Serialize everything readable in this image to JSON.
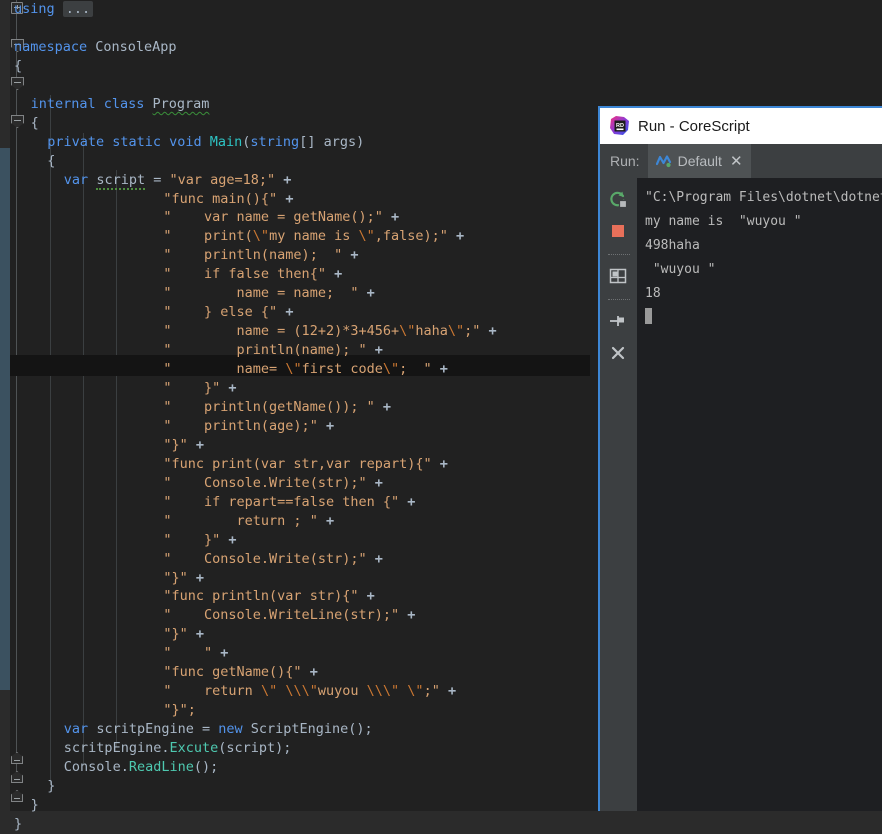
{
  "editor": {
    "language": "csharp",
    "collapsed_region_label": "...",
    "current_line_index": 15,
    "lines": [
      {
        "indent": 0,
        "tokens": [
          {
            "t": "using ",
            "c": "kw2"
          },
          {
            "t": "...",
            "c": "folded"
          }
        ]
      },
      {
        "indent": 0,
        "tokens": []
      },
      {
        "indent": 0,
        "tokens": [
          {
            "t": "namespace ",
            "c": "kw2"
          },
          {
            "t": "ConsoleApp",
            "c": "plain"
          }
        ]
      },
      {
        "indent": 0,
        "tokens": [
          {
            "t": "{",
            "c": "plain"
          }
        ]
      },
      {
        "indent": 0,
        "tokens": []
      },
      {
        "indent": 1,
        "tokens": [
          {
            "t": "internal ",
            "c": "kw2"
          },
          {
            "t": "class ",
            "c": "kw2"
          },
          {
            "t": "Program",
            "c": "plain wavy"
          }
        ]
      },
      {
        "indent": 1,
        "tokens": [
          {
            "t": "{",
            "c": "plain"
          }
        ]
      },
      {
        "indent": 2,
        "tokens": [
          {
            "t": "private ",
            "c": "kw2"
          },
          {
            "t": "static ",
            "c": "kw2"
          },
          {
            "t": "void ",
            "c": "kw2"
          },
          {
            "t": "Main",
            "c": "mainm"
          },
          {
            "t": "(",
            "c": "plain"
          },
          {
            "t": "string",
            "c": "kw2"
          },
          {
            "t": "[] args)",
            "c": "plain"
          }
        ]
      },
      {
        "indent": 2,
        "tokens": [
          {
            "t": "{",
            "c": "plain"
          }
        ]
      },
      {
        "indent": 3,
        "tokens": [
          {
            "t": "var ",
            "c": "kw2"
          },
          {
            "t": "script",
            "c": "plain dotted"
          },
          {
            "t": " = ",
            "c": "plain"
          },
          {
            "t": "\"var age=18;\"",
            "c": "str"
          },
          {
            "t": " +",
            "c": "plusop"
          }
        ]
      },
      {
        "indent": 9,
        "tokens": [
          {
            "t": "\"func main(){\"",
            "c": "str"
          },
          {
            "t": " +",
            "c": "plusop"
          }
        ]
      },
      {
        "indent": 9,
        "tokens": [
          {
            "t": "\"    var name = getName();\"",
            "c": "str"
          },
          {
            "t": " +",
            "c": "plusop"
          }
        ]
      },
      {
        "indent": 9,
        "tokens": [
          {
            "t": "\"    print(",
            "c": "str"
          },
          {
            "t": "\\\"",
            "c": "esc"
          },
          {
            "t": "my name is ",
            "c": "str"
          },
          {
            "t": "\\\"",
            "c": "esc"
          },
          {
            "t": ",false);\"",
            "c": "str"
          },
          {
            "t": " +",
            "c": "plusop"
          }
        ]
      },
      {
        "indent": 9,
        "tokens": [
          {
            "t": "\"    println(name);  \"",
            "c": "str"
          },
          {
            "t": " +",
            "c": "plusop"
          }
        ]
      },
      {
        "indent": 9,
        "tokens": [
          {
            "t": "\"    if false then{\"",
            "c": "str"
          },
          {
            "t": " +",
            "c": "plusop"
          }
        ]
      },
      {
        "indent": 9,
        "tokens": [
          {
            "t": "\"        name = name;  \"",
            "c": "str"
          },
          {
            "t": " +",
            "c": "plusop"
          }
        ]
      },
      {
        "indent": 9,
        "tokens": [
          {
            "t": "\"    } else {\"",
            "c": "str"
          },
          {
            "t": " +",
            "c": "plusop"
          }
        ]
      },
      {
        "indent": 9,
        "tokens": [
          {
            "t": "\"        name = (12+2)*3+456+",
            "c": "str"
          },
          {
            "t": "\\\"",
            "c": "esc"
          },
          {
            "t": "haha",
            "c": "str"
          },
          {
            "t": "\\\"",
            "c": "esc"
          },
          {
            "t": ";\"",
            "c": "str"
          },
          {
            "t": " +",
            "c": "plusop"
          }
        ]
      },
      {
        "indent": 9,
        "tokens": [
          {
            "t": "\"        println(name); \"",
            "c": "str"
          },
          {
            "t": " +",
            "c": "plusop"
          }
        ]
      },
      {
        "indent": 9,
        "tokens": [
          {
            "t": "\"        name= ",
            "c": "str"
          },
          {
            "t": "\\\"",
            "c": "esc"
          },
          {
            "t": "first code",
            "c": "str"
          },
          {
            "t": "\\\"",
            "c": "esc"
          },
          {
            "t": ";  \"",
            "c": "str"
          },
          {
            "t": " +",
            "c": "plusop"
          }
        ]
      },
      {
        "indent": 9,
        "tokens": [
          {
            "t": "\"    }\"",
            "c": "str"
          },
          {
            "t": " +",
            "c": "plusop"
          }
        ]
      },
      {
        "indent": 9,
        "tokens": [
          {
            "t": "\"    println(getName()); \"",
            "c": "str"
          },
          {
            "t": " +",
            "c": "plusop"
          }
        ]
      },
      {
        "indent": 9,
        "tokens": [
          {
            "t": "\"    println(age);\"",
            "c": "str"
          },
          {
            "t": " +",
            "c": "plusop"
          }
        ]
      },
      {
        "indent": 9,
        "tokens": [
          {
            "t": "\"}\"",
            "c": "str"
          },
          {
            "t": " +",
            "c": "plusop"
          }
        ]
      },
      {
        "indent": 9,
        "tokens": [
          {
            "t": "\"func print(var str,var repart){\"",
            "c": "str"
          },
          {
            "t": " +",
            "c": "plusop"
          }
        ]
      },
      {
        "indent": 9,
        "tokens": [
          {
            "t": "\"    Console.Write(str);\"",
            "c": "str"
          },
          {
            "t": " +",
            "c": "plusop"
          }
        ]
      },
      {
        "indent": 9,
        "tokens": [
          {
            "t": "\"    if repart==false then {\"",
            "c": "str"
          },
          {
            "t": " +",
            "c": "plusop"
          }
        ]
      },
      {
        "indent": 9,
        "tokens": [
          {
            "t": "\"        return ; \"",
            "c": "str"
          },
          {
            "t": " +",
            "c": "plusop"
          }
        ]
      },
      {
        "indent": 9,
        "tokens": [
          {
            "t": "\"    }\"",
            "c": "str"
          },
          {
            "t": " +",
            "c": "plusop"
          }
        ]
      },
      {
        "indent": 9,
        "tokens": [
          {
            "t": "\"    Console.Write(str);\"",
            "c": "str"
          },
          {
            "t": " +",
            "c": "plusop"
          }
        ]
      },
      {
        "indent": 9,
        "tokens": [
          {
            "t": "\"}\"",
            "c": "str"
          },
          {
            "t": " +",
            "c": "plusop"
          }
        ]
      },
      {
        "indent": 9,
        "tokens": [
          {
            "t": "\"func println(var str){\"",
            "c": "str"
          },
          {
            "t": " +",
            "c": "plusop"
          }
        ]
      },
      {
        "indent": 9,
        "tokens": [
          {
            "t": "\"    Console.WriteLine(str);\"",
            "c": "str"
          },
          {
            "t": " +",
            "c": "plusop"
          }
        ]
      },
      {
        "indent": 9,
        "tokens": [
          {
            "t": "\"}\"",
            "c": "str"
          },
          {
            "t": " +",
            "c": "plusop"
          }
        ]
      },
      {
        "indent": 9,
        "tokens": [
          {
            "t": "\"    \"",
            "c": "str"
          },
          {
            "t": " +",
            "c": "plusop"
          }
        ]
      },
      {
        "indent": 9,
        "tokens": [
          {
            "t": "\"func getName(){\"",
            "c": "str"
          },
          {
            "t": " +",
            "c": "plusop"
          }
        ]
      },
      {
        "indent": 9,
        "tokens": [
          {
            "t": "\"    return ",
            "c": "str"
          },
          {
            "t": "\\\"",
            "c": "esc"
          },
          {
            "t": " ",
            "c": "str"
          },
          {
            "t": "\\\\\\\"",
            "c": "esc"
          },
          {
            "t": "wuyou ",
            "c": "str"
          },
          {
            "t": "\\\\\\\"",
            "c": "esc"
          },
          {
            "t": " ",
            "c": "str"
          },
          {
            "t": "\\\"",
            "c": "esc"
          },
          {
            "t": ";\"",
            "c": "str"
          },
          {
            "t": " +",
            "c": "plusop"
          }
        ]
      },
      {
        "indent": 9,
        "tokens": [
          {
            "t": "\"}\";",
            "c": "str"
          }
        ]
      },
      {
        "indent": 3,
        "tokens": [
          {
            "t": "var ",
            "c": "kw2"
          },
          {
            "t": "scritpEngine = ",
            "c": "plain"
          },
          {
            "t": "new ",
            "c": "kw2"
          },
          {
            "t": "ScriptEngine();",
            "c": "plain"
          }
        ]
      },
      {
        "indent": 3,
        "tokens": [
          {
            "t": "scritpEngine.",
            "c": "plain"
          },
          {
            "t": "Excute",
            "c": "meth"
          },
          {
            "t": "(script);",
            "c": "plain"
          }
        ]
      },
      {
        "indent": 3,
        "tokens": [
          {
            "t": "Console.",
            "c": "plain"
          },
          {
            "t": "ReadLine",
            "c": "meth"
          },
          {
            "t": "();",
            "c": "plain"
          }
        ]
      },
      {
        "indent": 2,
        "tokens": [
          {
            "t": "}",
            "c": "plain"
          }
        ]
      },
      {
        "indent": 1,
        "tokens": [
          {
            "t": "}",
            "c": "plain"
          }
        ]
      },
      {
        "indent": 0,
        "tokens": [
          {
            "t": "}",
            "c": "plain"
          }
        ]
      }
    ]
  },
  "run_panel": {
    "title": "Run - CoreScript",
    "logo_label": "RD",
    "run_label": "Run:",
    "tab": {
      "label": "Default",
      "close_label": "✕",
      "icon": "run-config-icon"
    },
    "toolbar": [
      {
        "name": "rerun-button",
        "icon": "rerun-icon",
        "title": "Rerun"
      },
      {
        "name": "stop-button",
        "icon": "stop-icon",
        "title": "Stop"
      },
      {
        "name": "layout-button",
        "icon": "layout-icon",
        "title": "Layout Settings"
      },
      {
        "name": "pin-button",
        "icon": "pin-icon",
        "title": "Pin Tab"
      },
      {
        "name": "close-button",
        "icon": "close-icon",
        "title": "Close"
      }
    ],
    "console_lines": [
      "\"C:\\Program Files\\dotnet\\dotnet.",
      "my name is  \"wuyou \"",
      "498haha",
      " \"wuyou \"",
      "18"
    ]
  },
  "colors": {
    "editor_bg": "#212121",
    "gutter_bg": "#2b2b2b",
    "change_marker": "#3b5160",
    "current_line": "#141414",
    "keyword": "#5394ec",
    "string": "#d8a373",
    "escape": "#cc7832",
    "method": "#4ec9b0",
    "plain": "#a9b7c6",
    "panel_bg": "#3c3f41",
    "panel_border": "#3d87d6",
    "console_bg": "#1e1f22",
    "stop_icon": "#e8705a",
    "rerun_icon": "#59a869"
  }
}
